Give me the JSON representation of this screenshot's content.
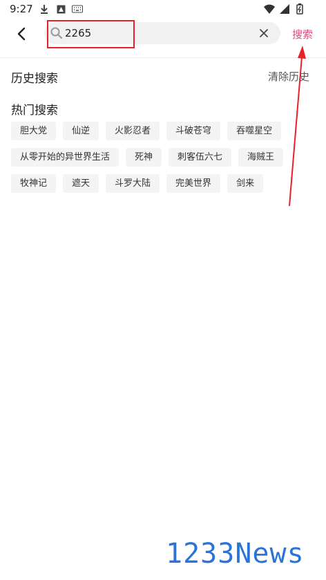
{
  "status_bar": {
    "time": "9:27",
    "left_icons": [
      "download-icon",
      "image-icon",
      "keyboard-icon"
    ],
    "right_icons": [
      "wifi-icon",
      "signal-icon",
      "battery-icon"
    ]
  },
  "header": {
    "search_value": "2265",
    "search_button_label": "搜索",
    "accent_color": "#e8467a"
  },
  "history": {
    "title": "历史搜索",
    "clear_label": "清除历史"
  },
  "hot": {
    "title": "热门搜索",
    "rows": [
      [
        "胆大党",
        "仙逆",
        "火影忍者",
        "斗破苍穹",
        "吞噬星空"
      ],
      [
        "从零开始的异世界生活",
        "死神",
        "刺客伍六七",
        "海贼王"
      ],
      [
        "牧神记",
        "遮天",
        "斗罗大陆",
        "完美世界",
        "剑来"
      ]
    ]
  },
  "watermark": "1233News"
}
